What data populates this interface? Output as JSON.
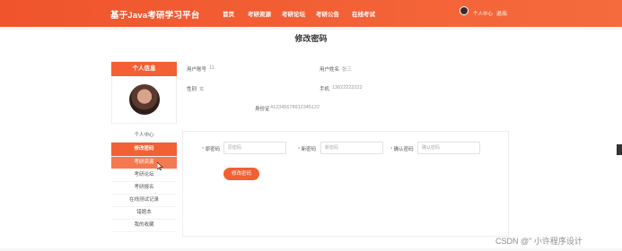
{
  "header": {
    "brand": "基于Java考研学习平台",
    "nav": [
      "首页",
      "考研资源",
      "考研论坛",
      "考研公告",
      "在线考试"
    ],
    "user_center": "个人中心",
    "logout": "退出"
  },
  "page": {
    "title": "修改密码"
  },
  "sidebar": {
    "heading": "个人信息",
    "menu": [
      "个人中心",
      "修改密码",
      "考研资源",
      "考研论坛",
      "考研报名",
      "在线测试记录",
      "错题本",
      "我的收藏"
    ],
    "active_index": 1,
    "hover_index": 2
  },
  "profile": {
    "account_label": "用户账号",
    "account_value": "11",
    "name_label": "用户姓名",
    "name_value": "张三",
    "gender_label": "性别",
    "gender_value": "女",
    "phone_label": "手机",
    "phone_value": "13622222222",
    "id_label": "身份证",
    "id_value": "412345678912345122"
  },
  "password_form": {
    "old_label": "原密码",
    "old_placeholder": "原密码",
    "new_label": "新密码",
    "new_placeholder": "新密码",
    "confirm_label": "确认密码",
    "confirm_placeholder": "确认密码",
    "required_mark": "*",
    "submit_label": "修改密码"
  },
  "watermark": "CSDN @\" 小许程序设计",
  "colors": {
    "accent": "#f26033",
    "header_gradient_end": "#f56b3d"
  },
  "icons": {
    "avatar": "user-avatar-icon",
    "cursor": "mouse-pointer-icon"
  }
}
